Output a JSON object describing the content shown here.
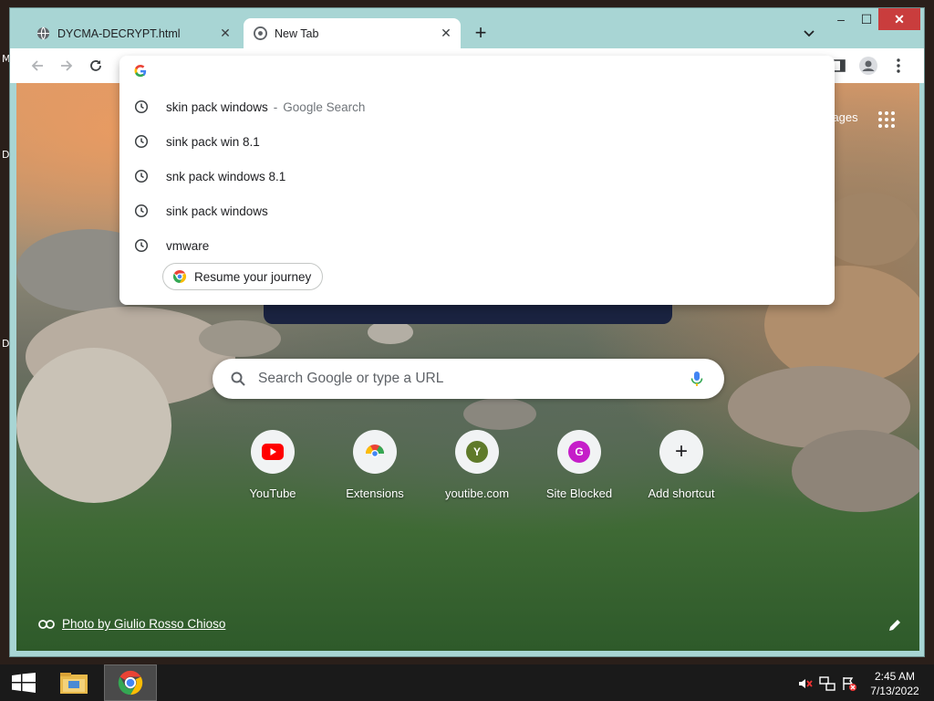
{
  "desktop": {
    "edge_letters": [
      "M",
      "D",
      "D"
    ]
  },
  "tabs": [
    {
      "title": "DYCMA-DECRYPT.html",
      "active": false,
      "favicon": "globe-icon"
    },
    {
      "title": "New Tab",
      "active": true,
      "favicon": "chrome-icon"
    }
  ],
  "tab_strip": {
    "new_tab_symbol": "+"
  },
  "window_controls": {
    "minimize": "–",
    "maximize": "☐",
    "close": "✕"
  },
  "omnibox": {
    "value": "",
    "suggestions": [
      {
        "text": "skin pack windows",
        "suffix": "Google Search",
        "separator": "-"
      },
      {
        "text": "sink pack win 8.1",
        "suffix": "",
        "separator": ""
      },
      {
        "text": "snk pack windows 8.1",
        "suffix": "",
        "separator": ""
      },
      {
        "text": "sink pack windows",
        "suffix": "",
        "separator": ""
      },
      {
        "text": "vmware",
        "suffix": "",
        "separator": ""
      }
    ],
    "journey_chip": "Resume your journey"
  },
  "ntp": {
    "images_link": "Images",
    "search_placeholder": "Search Google or type a URL",
    "shortcuts": [
      {
        "label": "YouTube",
        "icon": "youtube-icon",
        "badge": "",
        "badge_color": "#ff0000"
      },
      {
        "label": "Extensions",
        "icon": "chrome-web-store-icon",
        "badge": "",
        "badge_color": ""
      },
      {
        "label": "youtibe.com",
        "icon": "letter-badge",
        "badge": "Y",
        "badge_color": "#5f7a2a"
      },
      {
        "label": "Site Blocked",
        "icon": "letter-badge",
        "badge": "G",
        "badge_color": "#c51ec9"
      },
      {
        "label": "Add shortcut",
        "icon": "plus-icon",
        "badge": "+",
        "badge_color": ""
      }
    ],
    "photo_credit": "Photo by Giulio Rosso Chioso"
  },
  "taskbar": {
    "time": "2:45 AM",
    "date": "7/13/2022"
  },
  "colors": {
    "frame": "#a8d5d4",
    "close_button": "#c93d3d",
    "taskbar": "#1a1a1a"
  }
}
